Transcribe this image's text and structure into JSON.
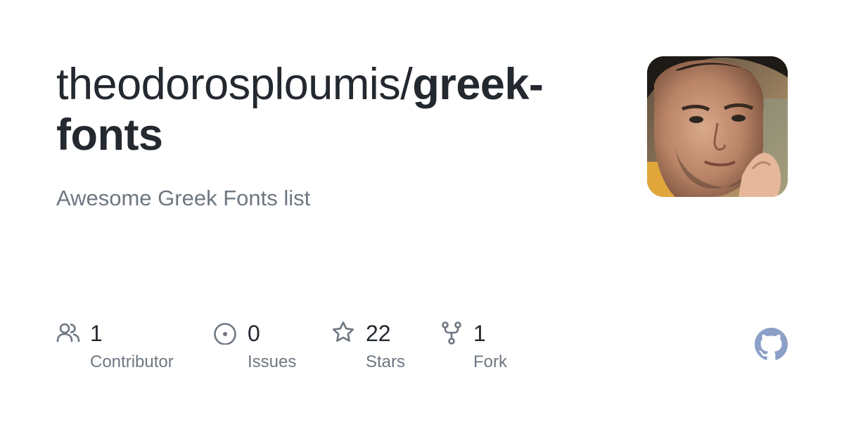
{
  "repo": {
    "owner": "theodorosploumis/",
    "name": "greek-fonts",
    "description": "Awesome Greek Fonts list"
  },
  "stats": {
    "contributors": {
      "count": "1",
      "label": "Contributor",
      "icon": "people-icon"
    },
    "issues": {
      "count": "0",
      "label": "Issues",
      "icon": "issue-opened-icon"
    },
    "stars": {
      "count": "22",
      "label": "Stars",
      "icon": "star-icon"
    },
    "forks": {
      "count": "1",
      "label": "Fork",
      "icon": "repo-forked-icon"
    }
  },
  "colors": {
    "text": "#24292f",
    "muted": "#6e7781",
    "icon": "#6e7781",
    "github_mark": "#8b9fc7"
  }
}
